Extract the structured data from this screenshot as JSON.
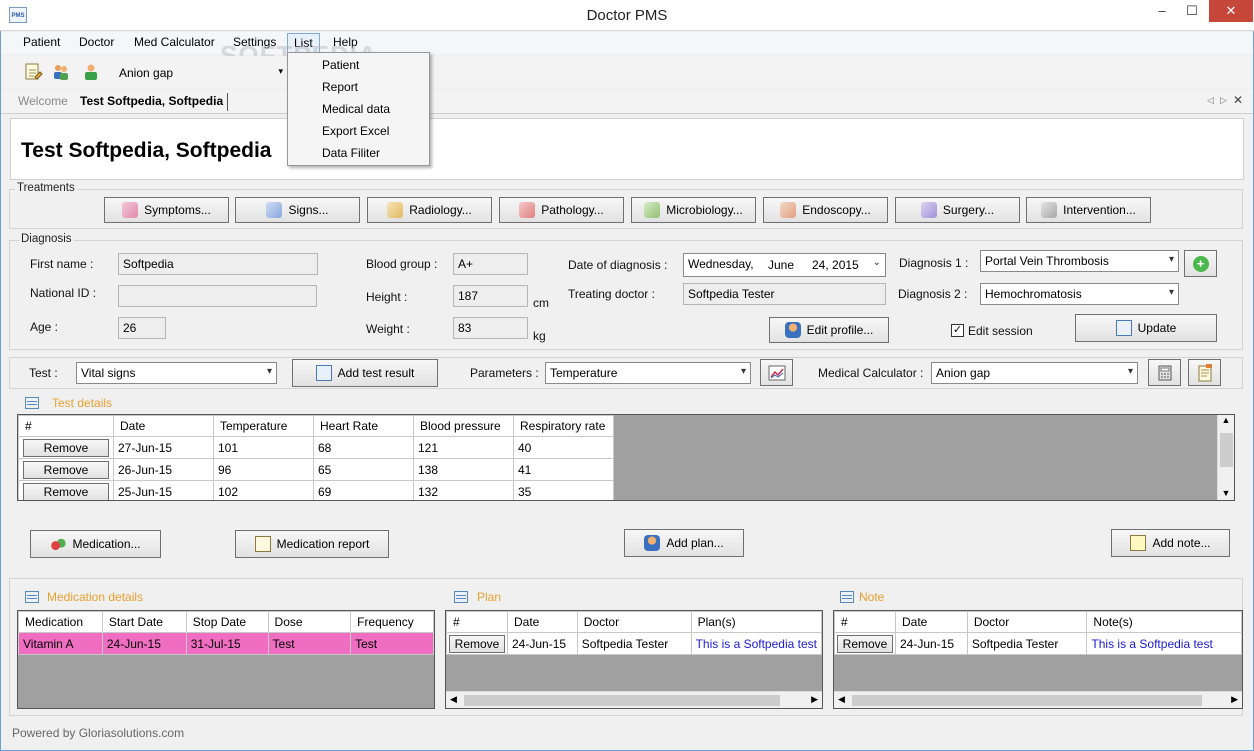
{
  "window": {
    "title": "Doctor PMS",
    "app_icon_text": "PMS"
  },
  "menu": {
    "items": [
      "Patient",
      "Doctor",
      "Med Calculator",
      "Settings",
      "List",
      "Help"
    ]
  },
  "list_menu": {
    "items": [
      "Patient",
      "Report",
      "Medical data",
      "Export Excel",
      "Data Filiter"
    ]
  },
  "toolbar": {
    "calculator_value": "Anion gap"
  },
  "watermark": "SOFTPEDIA",
  "tabs": {
    "welcome": "Welcome",
    "active": "Test Softpedia, Softpedia"
  },
  "patient": {
    "display_name": "Test Softpedia, Softpedia"
  },
  "treatments": {
    "label": "Treatments",
    "buttons": [
      "Symptoms...",
      "Signs...",
      "Radiology...",
      "Pathology...",
      "Microbiology...",
      "Endoscopy...",
      "Surgery...",
      "Intervention..."
    ]
  },
  "diagnosis": {
    "label": "Diagnosis",
    "first_name_label": "First name :",
    "first_name": "Softpedia",
    "national_id_label": "National ID :",
    "national_id": "",
    "age_label": "Age :",
    "age": "26",
    "blood_group_label": "Blood group :",
    "blood_group": "A+",
    "height_label": "Height :",
    "height": "187",
    "height_unit": "cm",
    "weight_label": "Weight :",
    "weight": "83",
    "weight_unit": "kg",
    "date_label": "Date of diagnosis :",
    "date_weekday": "Wednesday,",
    "date_month": "June",
    "date_day": "24, 2015",
    "doctor_label": "Treating doctor :",
    "doctor": "Softpedia Tester",
    "diag1_label": "Diagnosis 1 :",
    "diag1": "Portal Vein Thrombosis",
    "diag2_label": "Diagnosis 2 :",
    "diag2": "Hemochromatosis",
    "edit_profile": "Edit profile...",
    "edit_session": "Edit session",
    "update": "Update"
  },
  "test_bar": {
    "test_label": "Test :",
    "test_value": "Vital signs",
    "add_result": "Add test result",
    "params_label": "Parameters :",
    "params_value": "Temperature",
    "calc_label": "Medical Calculator :",
    "calc_value": "Anion gap"
  },
  "test_details": {
    "title": "Test details",
    "columns": [
      "#",
      "Date",
      "Temperature",
      "Heart Rate",
      "Blood pressure",
      "Respiratory rate"
    ],
    "remove_label": "Remove",
    "rows": [
      [
        "27-Jun-15",
        "101",
        "68",
        "121",
        "40"
      ],
      [
        "26-Jun-15",
        "96",
        "65",
        "138",
        "41"
      ],
      [
        "25-Jun-15",
        "102",
        "69",
        "132",
        "35"
      ]
    ]
  },
  "actions": {
    "medication": "Medication...",
    "medication_report": "Medication report",
    "add_plan": "Add plan...",
    "add_note": "Add note..."
  },
  "medication_details": {
    "title": "Medication details",
    "columns": [
      "Medication",
      "Start Date",
      "Stop Date",
      "Dose",
      "Frequency"
    ],
    "rows": [
      [
        "Vitamin A",
        "24-Jun-15",
        "31-Jul-15",
        "Test",
        "Test"
      ]
    ],
    "highlight_color": "#f06ec2"
  },
  "plan": {
    "title": "Plan",
    "columns": [
      "#",
      "Date",
      "Doctor",
      "Plan(s)"
    ],
    "remove_label": "Remove",
    "row": {
      "date": "24-Jun-15",
      "doctor": "Softpedia Tester",
      "text": "This is a Softpedia test"
    }
  },
  "note": {
    "title": "Note",
    "columns": [
      "#",
      "Date",
      "Doctor",
      "Note(s)"
    ],
    "remove_label": "Remove",
    "row": {
      "date": "24-Jun-15",
      "doctor": "Softpedia Tester",
      "text": "This is a Softpedia test"
    }
  },
  "status": "Powered by Gloriasolutions.com",
  "colors": {
    "section_title": "#e8a030",
    "link_text": "#1a1ad0",
    "highlight": "#f06ec2"
  }
}
